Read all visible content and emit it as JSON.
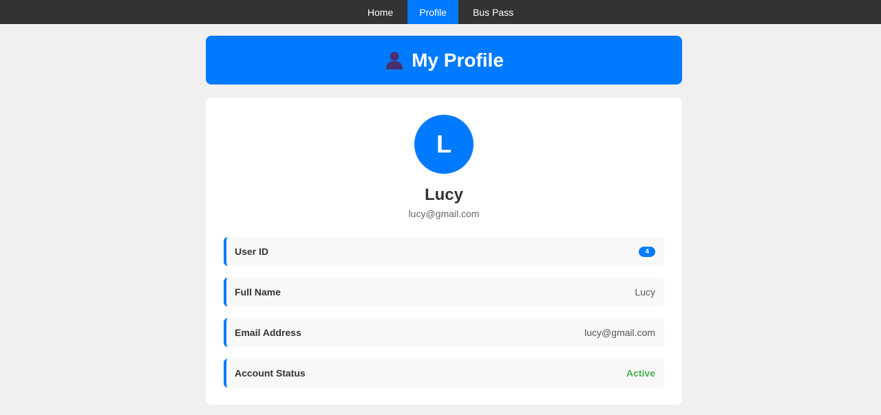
{
  "nav": {
    "items": [
      {
        "label": "Home"
      },
      {
        "label": "Profile"
      },
      {
        "label": "Bus Pass"
      }
    ],
    "active": "Profile"
  },
  "header": {
    "icon": "bust-in-silhouette-icon",
    "title": "My Profile"
  },
  "profile": {
    "avatar_initial": "L",
    "name": "Lucy",
    "email": "lucy@gmail.com"
  },
  "details": {
    "user_id": {
      "label": "User ID",
      "value": "4"
    },
    "full_name": {
      "label": "Full Name",
      "value": "Lucy"
    },
    "email": {
      "label": "Email Address",
      "value": "lucy@gmail.com"
    },
    "status": {
      "label": "Account Status",
      "value": "Active"
    }
  },
  "colors": {
    "accent": "#007bff",
    "nav_bg": "#333333",
    "page_bg": "#f0f0f0",
    "status_active": "#4caf50"
  }
}
